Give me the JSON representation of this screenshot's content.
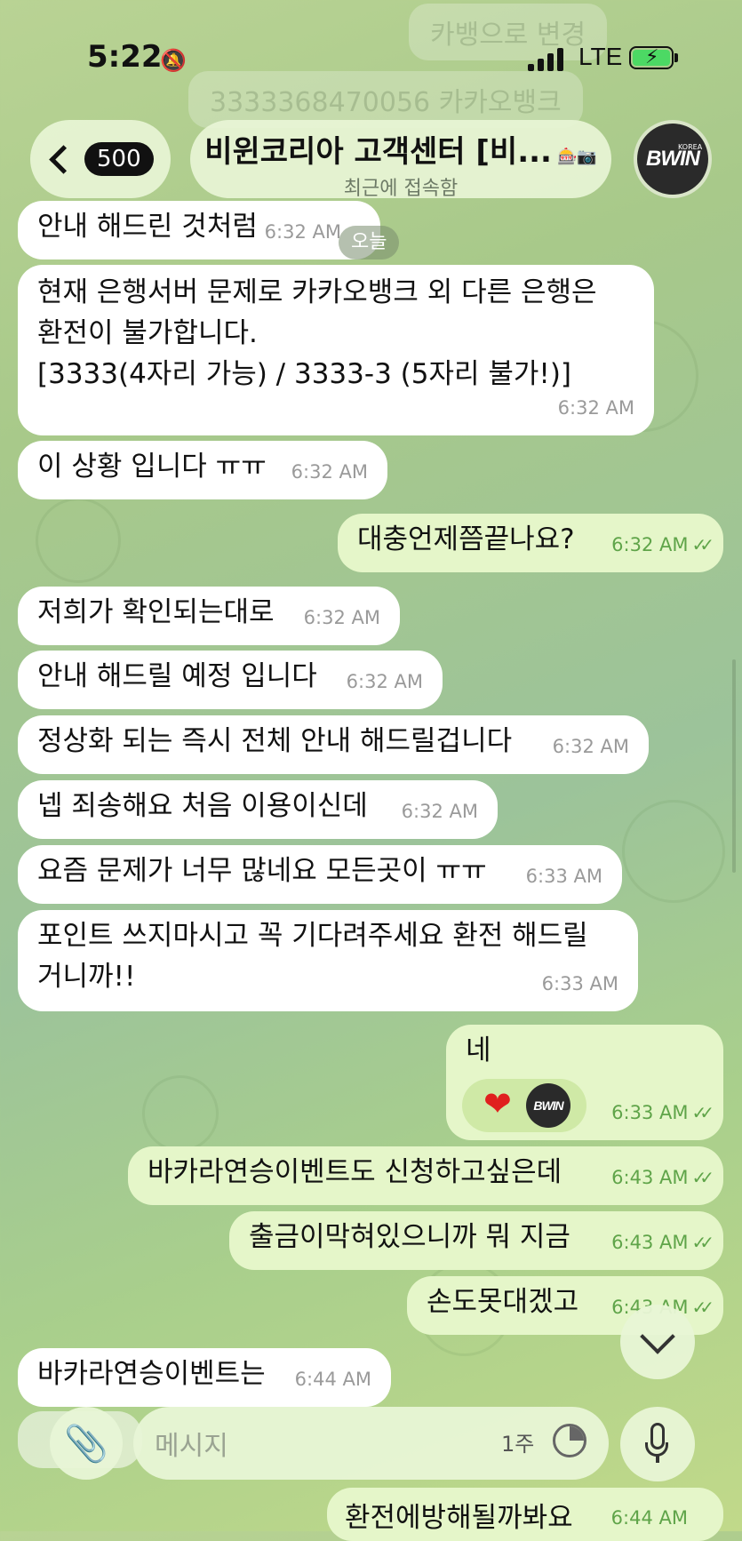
{
  "status_bar": {
    "time": "5:22",
    "network": "LTE"
  },
  "ghost_top": {
    "line1": "카뱅으로 변경",
    "line2": "3333368470056 카카오뱅크"
  },
  "header": {
    "back_count": "500",
    "title": "비윈코리아 고객센터 [비...",
    "title_emoji": "🎰📷",
    "subtitle": "최근에 접속함",
    "avatar_logo": "BWIN",
    "avatar_logo_small": "KOREA"
  },
  "date_pill": "오늘",
  "messages": [
    {
      "dir": "in",
      "text": "안내 해드린 것처럼",
      "time": "6:32 AM"
    },
    {
      "dir": "in",
      "text": "현재 은행서버 문제로 카카오뱅크 외 다른 은행은\n환전이 불가합니다.\n[3333(4자리 가능) / 3333-3 (5자리 불가!)]",
      "time": "6:32 AM"
    },
    {
      "dir": "in",
      "text": "이 상황 입니다 ㅠㅠ",
      "time": "6:32 AM"
    },
    {
      "dir": "out",
      "text": "대충언제쯤끝나요?",
      "time": "6:32 AM"
    },
    {
      "dir": "in",
      "text": "저희가 확인되는대로",
      "time": "6:32 AM"
    },
    {
      "dir": "in",
      "text": "안내 해드릴 예정 입니다",
      "time": "6:32 AM"
    },
    {
      "dir": "in",
      "text": "정상화 되는 즉시 전체 안내 해드릴겁니다",
      "time": "6:32 AM"
    },
    {
      "dir": "in",
      "text": "넵 죄송해요 처음 이용이신데",
      "time": "6:32 AM"
    },
    {
      "dir": "in",
      "text": "요즘 문제가 너무 많네요 모든곳이 ㅠㅠ",
      "time": "6:33 AM"
    },
    {
      "dir": "in",
      "text": "포인트 쓰지마시고 꼭 기다려주세요 환전 해드릴\n거니까!!",
      "time": "6:33 AM"
    },
    {
      "dir": "out",
      "text": "네",
      "time": "6:33 AM",
      "reaction": "❤"
    },
    {
      "dir": "out",
      "text": "바카라연승이벤트도 신청하고싶은데",
      "time": "6:43 AM"
    },
    {
      "dir": "out",
      "text": "출금이막혀있으니까 뭐 지금",
      "time": "6:43 AM"
    },
    {
      "dir": "out",
      "text": "손도못대겠고",
      "time": "6:43 AM"
    },
    {
      "dir": "in",
      "text": "바카라연승이벤트는",
      "time": "6:44 AM"
    }
  ],
  "partial_bottom": {
    "text": "환전에방해될까봐요",
    "time": "6:44 AM"
  },
  "input": {
    "placeholder": "메시지",
    "timer": "1주"
  }
}
